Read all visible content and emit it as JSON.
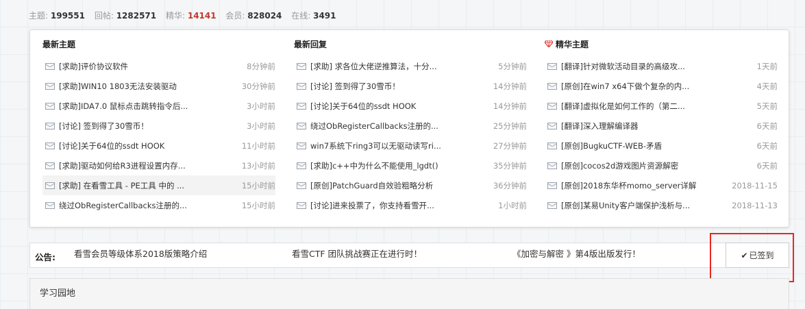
{
  "stats": {
    "topics_label": "主题:",
    "topics": "199551",
    "posts_label": "回帖:",
    "posts": "1282571",
    "essence_label": "精华:",
    "essence": "14141",
    "members_label": "会员:",
    "members": "828024",
    "online_label": "在线:",
    "online": "3491"
  },
  "columns": [
    {
      "header": "最新主题",
      "rows": [
        {
          "title": "[求助]评价协议软件",
          "time": "8分钟前"
        },
        {
          "title": "[求助]WIN10 1803无法安装驱动",
          "time": "30分钟前"
        },
        {
          "title": "[求助]IDA7.0 鼠标点击跳转指令后...",
          "time": "3小时前"
        },
        {
          "title": "[讨论] 签到得了30雪币！",
          "time": "3小时前"
        },
        {
          "title": "[讨论]关于64位的ssdt HOOK",
          "time": "11小时前"
        },
        {
          "title": "[求助]驱动如何给R3进程设置内存...",
          "time": "13小时前"
        },
        {
          "title": "[求助] 在看雪工具 - PE工具 中的 ...",
          "time": "15小时前"
        },
        {
          "title": "绕过ObRegisterCallbacks注册的...",
          "time": "15小时前"
        }
      ]
    },
    {
      "header": "最新回复",
      "rows": [
        {
          "title": "[求助] 求各位大佬逆推算法，十分...",
          "time": "5分钟前"
        },
        {
          "title": "[讨论] 签到得了30雪币！",
          "time": "14分钟前"
        },
        {
          "title": "[讨论]关于64位的ssdt HOOK",
          "time": "14分钟前"
        },
        {
          "title": "绕过ObRegisterCallbacks注册的...",
          "time": "25分钟前"
        },
        {
          "title": "win7系统下ring3可以无驱动读写ri...",
          "time": "27分钟前"
        },
        {
          "title": "[求助]c++中为什么不能使用_lgdt()",
          "time": "35分钟前"
        },
        {
          "title": "[原创]PatchGuard自效验粗略分析",
          "time": "36分钟前"
        },
        {
          "title": "[讨论]进来投票了，你支持看雪开...",
          "time": "1小时前"
        }
      ]
    },
    {
      "header": "精华主题",
      "rows": [
        {
          "title": "[翻译]针对微软活动目录的高级攻...",
          "time": "1天前"
        },
        {
          "title": "[原创]在win7 x64下做个复杂的内...",
          "time": "4天前"
        },
        {
          "title": "[翻译]虚拟化是如何工作的（第二...",
          "time": "5天前"
        },
        {
          "title": "[翻译]深入理解编译器",
          "time": "6天前"
        },
        {
          "title": "[原创]BugkuCTF-WEB-矛盾",
          "time": "6天前"
        },
        {
          "title": "[原创]cocos2d游戏图片资源解密",
          "time": "6天前"
        },
        {
          "title": "[原创]2018东华杯momo_server详解",
          "time": "2018-11-15"
        },
        {
          "title": "[原创]某易Unity客户端保护浅析与...",
          "time": "2018-11-13"
        }
      ]
    }
  ],
  "notice": {
    "label": "公告:",
    "items": [
      "看雪会员等级体系2018版策略介绍",
      "看雪CTF 团队挑战赛正在进行时！",
      "《加密与解密 》第4版出版发行！"
    ]
  },
  "sign": {
    "check": "✔",
    "label": "已签到"
  },
  "section": {
    "title": "学习园地"
  },
  "colors": {
    "highlight_red": "#e8261e",
    "essence_red": "#c0392b"
  }
}
